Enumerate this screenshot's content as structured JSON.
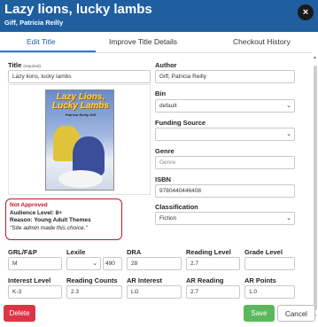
{
  "header": {
    "title": "Lazy lions, lucky lambs",
    "subtitle": "Giff, Patricia Reilly",
    "close_icon": "×"
  },
  "tabs": [
    {
      "label": "Edit Title",
      "active": true
    },
    {
      "label": "Improve Title Details",
      "active": false
    },
    {
      "label": "Checkout History",
      "active": false
    }
  ],
  "form": {
    "title": {
      "label": "Title",
      "required_note": "(required)",
      "value": "Lazy lions, lucky lambs"
    },
    "author": {
      "label": "Author",
      "value": "Giff, Patricia Reilly"
    },
    "bin": {
      "label": "Bin",
      "value": "default"
    },
    "funding_source": {
      "label": "Funding Source",
      "value": ""
    },
    "genre": {
      "label": "Genre",
      "placeholder": "Genre"
    },
    "isbn": {
      "label": "ISBN",
      "value": "9780440446408"
    },
    "classification": {
      "label": "Classification",
      "value": "Fiction"
    },
    "grl": {
      "label": "GRL/F&P",
      "value": "M"
    },
    "lexile": {
      "label": "Lexile",
      "select_value": "",
      "value": "490"
    },
    "dra": {
      "label": "DRA",
      "value": "28"
    },
    "reading_level": {
      "label": "Reading Level",
      "value": "2.7"
    },
    "grade_level": {
      "label": "Grade Level",
      "value": ""
    },
    "interest_level": {
      "label": "Interest Level",
      "value": "K-3"
    },
    "reading_counts": {
      "label": "Reading Counts",
      "value": "2.3"
    },
    "ar_interest": {
      "label": "AR Interest",
      "value": "LG"
    },
    "ar_reading": {
      "label": "AR Reading",
      "value": "2.7"
    },
    "ar_points": {
      "label": "AR Points",
      "value": "1.0"
    }
  },
  "cover": {
    "title_line1": "Lazy Lions,",
    "title_line2": "Lucky Lambs",
    "author_line": "Patricia Reilly Giff"
  },
  "notice": {
    "status": "Not Approved",
    "audience": "Audience Level: 8+",
    "reason": "Reason: Young Adult Themes",
    "note": "\"Site admin made this choice.\""
  },
  "buttons": {
    "delete": "Delete",
    "save": "Save",
    "cancel": "Cancel"
  },
  "colors": {
    "header": "#1f5fa0",
    "delete": "#dc3545",
    "save": "#5cb85c",
    "notice_border": "#c3182b"
  }
}
